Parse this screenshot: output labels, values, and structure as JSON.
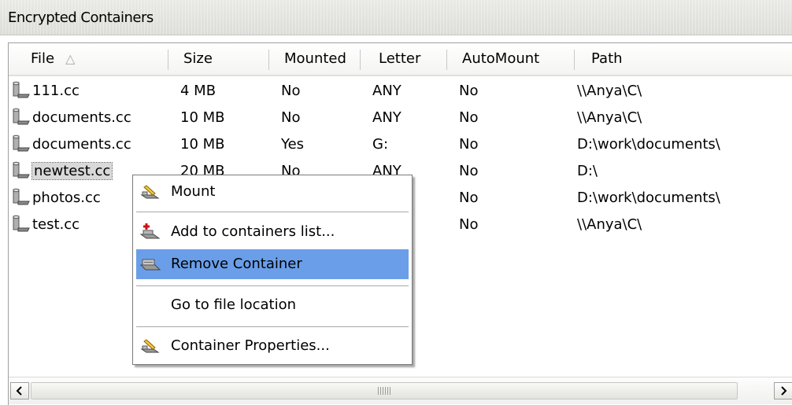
{
  "panel": {
    "title": "Encrypted Containers"
  },
  "table": {
    "columns": [
      "File",
      "Size",
      "Mounted",
      "Letter",
      "AutoMount",
      "Path"
    ],
    "sort_indicator": "△",
    "rows": [
      {
        "file": "111.cc",
        "size": "4 MB",
        "mounted": "No",
        "letter": "ANY",
        "automount": "No",
        "path": "\\\\Anya\\C\\"
      },
      {
        "file": "documents.cc",
        "size": "10 MB",
        "mounted": "No",
        "letter": "ANY",
        "automount": "No",
        "path": "\\\\Anya\\C\\"
      },
      {
        "file": "documents.cc",
        "size": "10 MB",
        "mounted": "Yes",
        "letter": "G:",
        "automount": "No",
        "path": "D:\\work\\documents\\"
      },
      {
        "file": "newtest.cc",
        "size": "20 MB",
        "mounted": "No",
        "letter": "ANY",
        "automount": "No",
        "path": "D:\\"
      },
      {
        "file": "photos.cc",
        "size": "",
        "mounted": "",
        "letter": "",
        "automount": "No",
        "path": "D:\\work\\documents\\"
      },
      {
        "file": "test.cc",
        "size": "",
        "mounted": "",
        "letter": "",
        "automount": "No",
        "path": "\\\\Anya\\C\\"
      }
    ]
  },
  "context_menu": {
    "items": [
      {
        "label": "Mount",
        "icon": "mount-icon"
      },
      {
        "label": "Add to containers list...",
        "icon": "add-container-icon"
      },
      {
        "label": "Remove Container",
        "icon": "remove-container-icon",
        "highlighted": true
      },
      {
        "label": "Go to file location",
        "icon": ""
      },
      {
        "label": "Container Properties...",
        "icon": "properties-icon"
      }
    ]
  },
  "colors": {
    "highlight": "#6a9ee8",
    "selected_row": "#d9d9d9"
  }
}
